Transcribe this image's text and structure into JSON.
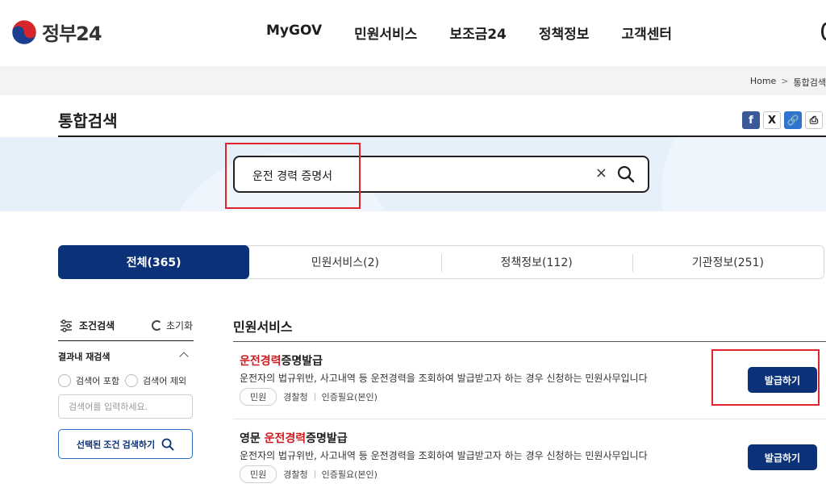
{
  "header": {
    "logo_text": "정부24",
    "nav": [
      "MyGOV",
      "민원서비스",
      "보조금24",
      "정책정보",
      "고객센터"
    ]
  },
  "breadcrumb": {
    "home": "Home",
    "sep": ">",
    "current": "통합검색"
  },
  "page_title": "통합검색",
  "share": {
    "facebook": "f",
    "x": "X",
    "link": "🔗",
    "print": "⎙"
  },
  "search": {
    "query": "운전 경력 증명서",
    "clear": "×"
  },
  "tabs": [
    {
      "label": "전체(365)",
      "active": true
    },
    {
      "label": "민원서비스(2)",
      "active": false
    },
    {
      "label": "정책정보(112)",
      "active": false
    },
    {
      "label": "기관정보(251)",
      "active": false
    }
  ],
  "filter": {
    "title": "조건검색",
    "reset": "초기화",
    "refine_label": "결과내 재검색",
    "include_label": "검색어 포함",
    "exclude_label": "검색어 제외",
    "input_placeholder": "검색어를 입력하세요.",
    "apply_button": "선택된 조건 검색하기"
  },
  "results": {
    "section_title": "민원서비스",
    "items": [
      {
        "title_prefix": "",
        "title_highlight": "운전경력",
        "title_suffix": "증명발급",
        "desc": "운전자의 법규위반, 사고내역 등 운전경력을 조회하여 발급받고자 하는 경우 신청하는 민원사무입니다",
        "chip": "민원",
        "agency": "경찰청",
        "auth": "인증필요(본인)",
        "button": "발급하기"
      },
      {
        "title_prefix": "영문 ",
        "title_highlight": "운전경력",
        "title_suffix": "증명발급",
        "desc": "운전자의 법규위반, 사고내역 등 운전경력을 조회하여 발급받고자 하는 경우 신청하는 민원사무입니다",
        "chip": "민원",
        "agency": "경찰청",
        "auth": "인증필요(본인)",
        "button": "발급하기"
      }
    ]
  },
  "colors": {
    "primary": "#0b3278",
    "highlight": "#d11a1f",
    "annotation": "#e0262c",
    "band": "#e6f0fb"
  }
}
